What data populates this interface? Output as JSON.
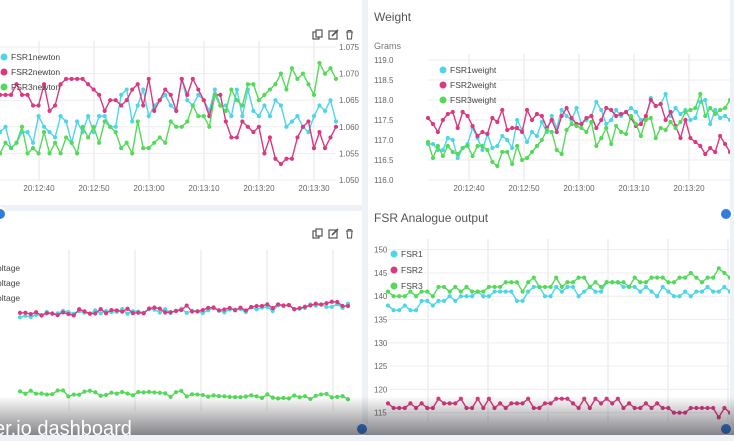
{
  "panels": {
    "top_left": {
      "title": "",
      "y_unit": "",
      "legend": [
        "FSR1newton",
        "FSR2newton",
        "FSR3newton"
      ],
      "y_ticks": [
        "1.075",
        "1.070",
        "1.065",
        "1.060",
        "1.055",
        "1.050"
      ],
      "x_ticks": [
        "20:12:40",
        "20:12:50",
        "20:13:00",
        "20:13:10",
        "20:13:20",
        "20:13:30"
      ]
    },
    "top_right": {
      "title": "Weight",
      "y_unit": "Grams",
      "legend": [
        "FSR1weight",
        "FSR2weight",
        "FSR3weight"
      ],
      "y_ticks": [
        "119.0",
        "118.5",
        "118.0",
        "117.5",
        "117.0",
        "116.5",
        "116.0"
      ],
      "x_ticks": [
        "20:12:40",
        "20:12:50",
        "20:13:00",
        "20:13:10",
        "20:13:20"
      ]
    },
    "bottom_left": {
      "title": "",
      "legend": [
        "oltage",
        "oltage",
        "oltage"
      ]
    },
    "bottom_right": {
      "title": "FSR Analogue output",
      "legend": [
        "FSR1",
        "FSR2",
        "FSR3"
      ],
      "y_ticks": [
        "150",
        "145",
        "140",
        "135",
        "130",
        "125",
        "120",
        "115"
      ]
    }
  },
  "overlay_text": "er.io dashboard",
  "colors": {
    "cyan": "#4fd5e6",
    "pink": "#d8397f",
    "green": "#55d95a",
    "handle": "#2f7de1"
  },
  "chart_data": [
    {
      "type": "line",
      "title": "",
      "x": [
        "20:12:40",
        "20:12:50",
        "20:13:00",
        "20:13:10",
        "20:13:20",
        "20:13:30"
      ],
      "ylim": [
        1.05,
        1.075
      ],
      "series": [
        {
          "name": "FSR1newton",
          "values": [
            1.059,
            1.06,
            1.064,
            1.066,
            1.063,
            1.062
          ]
        },
        {
          "name": "FSR2newton",
          "values": [
            1.066,
            1.066,
            1.066,
            1.066,
            1.056,
            1.06
          ]
        },
        {
          "name": "FSR3newton",
          "values": [
            1.058,
            1.058,
            1.058,
            1.062,
            1.066,
            1.07
          ]
        }
      ]
    },
    {
      "type": "line",
      "title": "Weight",
      "ylabel": "Grams",
      "x": [
        "20:12:40",
        "20:12:50",
        "20:13:00",
        "20:13:10",
        "20:13:20"
      ],
      "ylim": [
        116.0,
        119.0
      ],
      "series": [
        {
          "name": "FSR1weight",
          "values": [
            116.7,
            117.1,
            117.6,
            117.9,
            117.7
          ]
        },
        {
          "name": "FSR2weight",
          "values": [
            117.4,
            117.4,
            117.5,
            117.7,
            116.6
          ]
        },
        {
          "name": "FSR3weight",
          "values": [
            116.9,
            116.7,
            117.1,
            117.4,
            118.1
          ]
        }
      ]
    },
    {
      "type": "line",
      "title": "",
      "series": [
        {
          "name": "oltage",
          "values": [
            0.62,
            0.64,
            0.65,
            0.66,
            0.68
          ]
        },
        {
          "name": "oltage",
          "values": [
            0.63,
            0.64,
            0.66,
            0.67,
            0.69
          ]
        },
        {
          "name": "oltage",
          "values": [
            0.12,
            0.11,
            0.11,
            0.1,
            0.09
          ]
        }
      ]
    },
    {
      "type": "line",
      "title": "FSR Analogue output",
      "ylim": [
        113,
        151
      ],
      "series": [
        {
          "name": "FSR1",
          "values": [
            137,
            139,
            140,
            141,
            142,
            141,
            141
          ]
        },
        {
          "name": "FSR2",
          "values": [
            117,
            117,
            117,
            117,
            117,
            116,
            115
          ]
        },
        {
          "name": "FSR3",
          "values": [
            140,
            141,
            142,
            143,
            143,
            144,
            145
          ]
        }
      ]
    }
  ]
}
